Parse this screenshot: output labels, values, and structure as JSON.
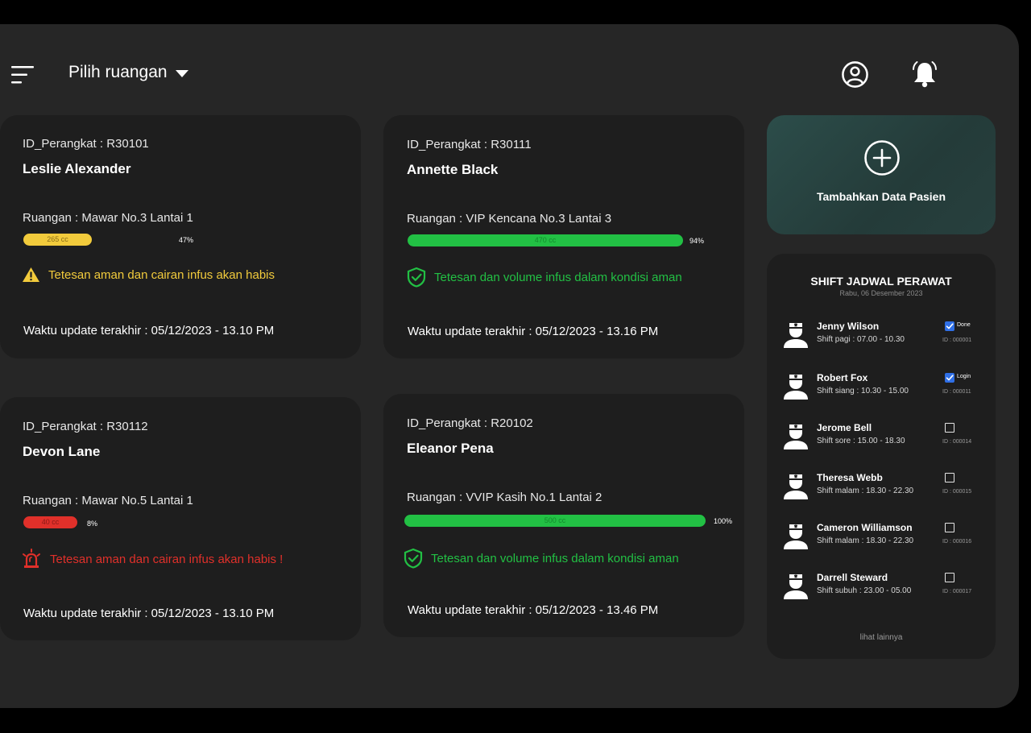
{
  "header": {
    "room_select_label": "Pilih ruangan"
  },
  "cards": [
    {
      "device_id": "ID_Perangkat : R30101",
      "patient": "Leslie Alexander",
      "room": "Ruangan : Mawar No.3 Lantai 1",
      "volume_label": "265 cc",
      "percent_label": "47%",
      "level_percent": 47,
      "status": "Tetesan aman dan cairan infus akan habis",
      "updated": "Waktu update terakhir : 05/12/2023 - 13.10 PM",
      "color": "#f2cb3c"
    },
    {
      "device_id": "ID_Perangkat : R30111",
      "patient": "Annette Black",
      "room": "Ruangan : VIP Kencana No.3 Lantai 3",
      "volume_label": "470 cc",
      "percent_label": "94%",
      "level_percent": 94,
      "status": "Tetesan dan volume infus dalam kondisi aman",
      "updated": "Waktu update terakhir : 05/12/2023 - 13.16 PM",
      "color": "#22c044"
    },
    {
      "device_id": "ID_Perangkat : R30112",
      "patient": "Devon Lane",
      "room": "Ruangan : Mawar No.5 Lantai 1",
      "volume_label": "40 cc",
      "percent_label": "8%",
      "level_percent": 8,
      "status": "Tetesan aman dan cairan infus akan habis !",
      "updated": "Waktu update terakhir : 05/12/2023 - 13.10 PM",
      "color": "#e0302a"
    },
    {
      "device_id": "ID_Perangkat : R20102",
      "patient": "Eleanor Pena",
      "room": "Ruangan : VVIP Kasih No.1 Lantai 2",
      "volume_label": "500 cc",
      "percent_label": "100%",
      "level_percent": 100,
      "status": "Tetesan dan volume infus dalam kondisi aman",
      "updated": "Waktu update terakhir : 05/12/2023 - 13.46 PM",
      "color": "#22c044"
    }
  ],
  "add_patient": {
    "label": "Tambahkan Data Pasien"
  },
  "shift": {
    "title": "SHIFT JADWAL PERAWAT",
    "date": "Rabu, 06 Desember 2023",
    "nurses": [
      {
        "name": "Jenny Wilson",
        "shift": "Shift pagi : 07.00 - 10.30",
        "id": "ID : 000001",
        "checked": true,
        "check_label": "Done"
      },
      {
        "name": "Robert Fox",
        "shift": "Shift siang : 10.30 - 15.00",
        "id": "ID : 000011",
        "checked": true,
        "check_label": "Login"
      },
      {
        "name": "Jerome Bell",
        "shift": "Shift sore : 15.00 - 18.30",
        "id": "ID : 000014",
        "checked": false,
        "check_label": ""
      },
      {
        "name": "Theresa Webb",
        "shift": "Shift malam : 18.30 - 22.30",
        "id": "ID : 000015",
        "checked": false,
        "check_label": ""
      },
      {
        "name": "Cameron Williamson",
        "shift": "Shift malam : 18.30 - 22.30",
        "id": "ID : 000016",
        "checked": false,
        "check_label": ""
      },
      {
        "name": "Darrell Steward",
        "shift": "Shift subuh : 23.00 - 05.00",
        "id": "ID : 000017",
        "checked": false,
        "check_label": ""
      }
    ],
    "more_label": "lihat lainnya"
  },
  "colors": {
    "background": "#262626",
    "card": "#1e1e1e",
    "warning": "#f2cb3c",
    "safe": "#22c044",
    "danger": "#e0302a",
    "check": "#2f6fe6"
  },
  "icons": {
    "menu": "menu-icon",
    "caret": "caret-down-icon",
    "user": "user-circle-icon",
    "bell": "bell-ringing-icon",
    "warning": "warning-triangle-icon",
    "safe": "shield-check-icon",
    "danger": "alarm-siren-icon",
    "add": "plus-circle-icon",
    "nurse": "nurse-avatar-icon",
    "checkbox": "checkbox-icon"
  }
}
